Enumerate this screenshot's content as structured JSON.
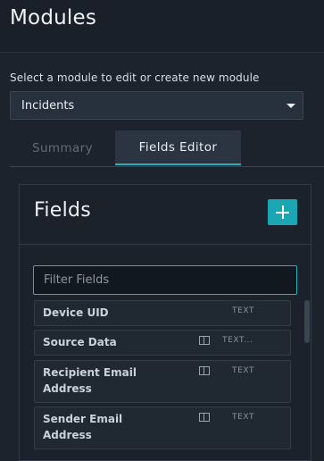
{
  "header": {
    "title": "Modules"
  },
  "module_selector": {
    "label": "Select a module to edit or create new module",
    "value": "Incidents"
  },
  "tabs": [
    {
      "label": "Summary",
      "active": false
    },
    {
      "label": "Fields Editor",
      "active": true
    }
  ],
  "fields_panel": {
    "title": "Fields",
    "add_button_icon": "plus-icon",
    "filter": {
      "placeholder": "Filter Fields",
      "value": ""
    },
    "fields": [
      {
        "name": "Device UID",
        "type": "TEXT",
        "has_table_icon": false
      },
      {
        "name": "Source Data",
        "type": "TEXT...",
        "has_table_icon": true
      },
      {
        "name": "Recipient Email Address",
        "type": "TEXT",
        "has_table_icon": true
      },
      {
        "name": "Sender Email Address",
        "type": "TEXT",
        "has_table_icon": true
      }
    ]
  },
  "colors": {
    "accent": "#27b1bd",
    "add_button": "#1aa7b3",
    "background": "#1c232c"
  }
}
